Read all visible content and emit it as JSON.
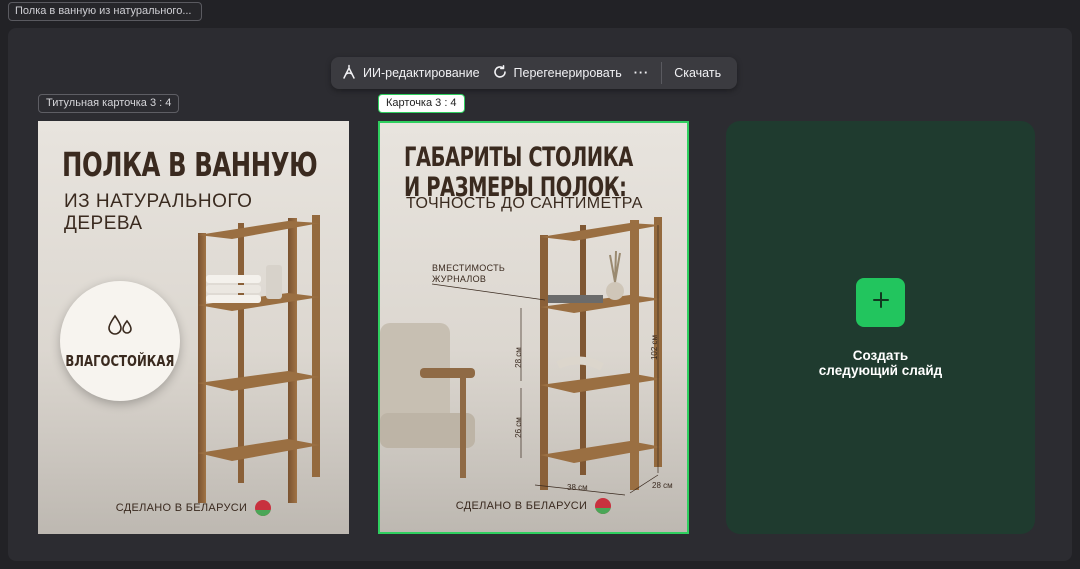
{
  "document": {
    "title": "Полка в ванную из натурального..."
  },
  "toolbar": {
    "ai_edit_label": "ИИ-редактирование",
    "regenerate_label": "Перегенерировать",
    "more_label": "···",
    "download_label": "Скачать"
  },
  "slides": [
    {
      "label": "Титульная карточка 3 : 4",
      "title": "ПОЛКА В ВАННУЮ",
      "subtitle_line1": "ИЗ НАТУРАЛЬНОГО",
      "subtitle_line2": "ДЕРЕВА",
      "badge": "ВЛАГОСТОЙКАЯ",
      "footer": "СДЕЛАНО В БЕЛАРУСИ"
    },
    {
      "label": "Карточка 3 : 4",
      "title_line1": "ГАБАРИТЫ СТОЛИКА",
      "title_line2": "И РАЗМЕРЫ ПОЛОК:",
      "subtitle": "ТОЧНОСТЬ ДО САНТИМЕТРА",
      "annotation_line1": "ВМЕСТИМОСТЬ",
      "annotation_line2": "ЖУРНАЛОВ",
      "dim_shelf_gap_1": "28 см",
      "dim_shelf_gap_2": "26 см",
      "dim_height": "102 см",
      "dim_width": "38 см",
      "dim_depth": "28 см",
      "footer": "СДЕЛАНО В БЕЛАРУСИ",
      "selected": true
    }
  ],
  "new_slide": {
    "label_line1": "Создать",
    "label_line2": "следующий слайд"
  },
  "colors": {
    "accent": "#22c55e",
    "new_slide_bg": "#1f3b2f",
    "workspace": "#2c2c31"
  }
}
